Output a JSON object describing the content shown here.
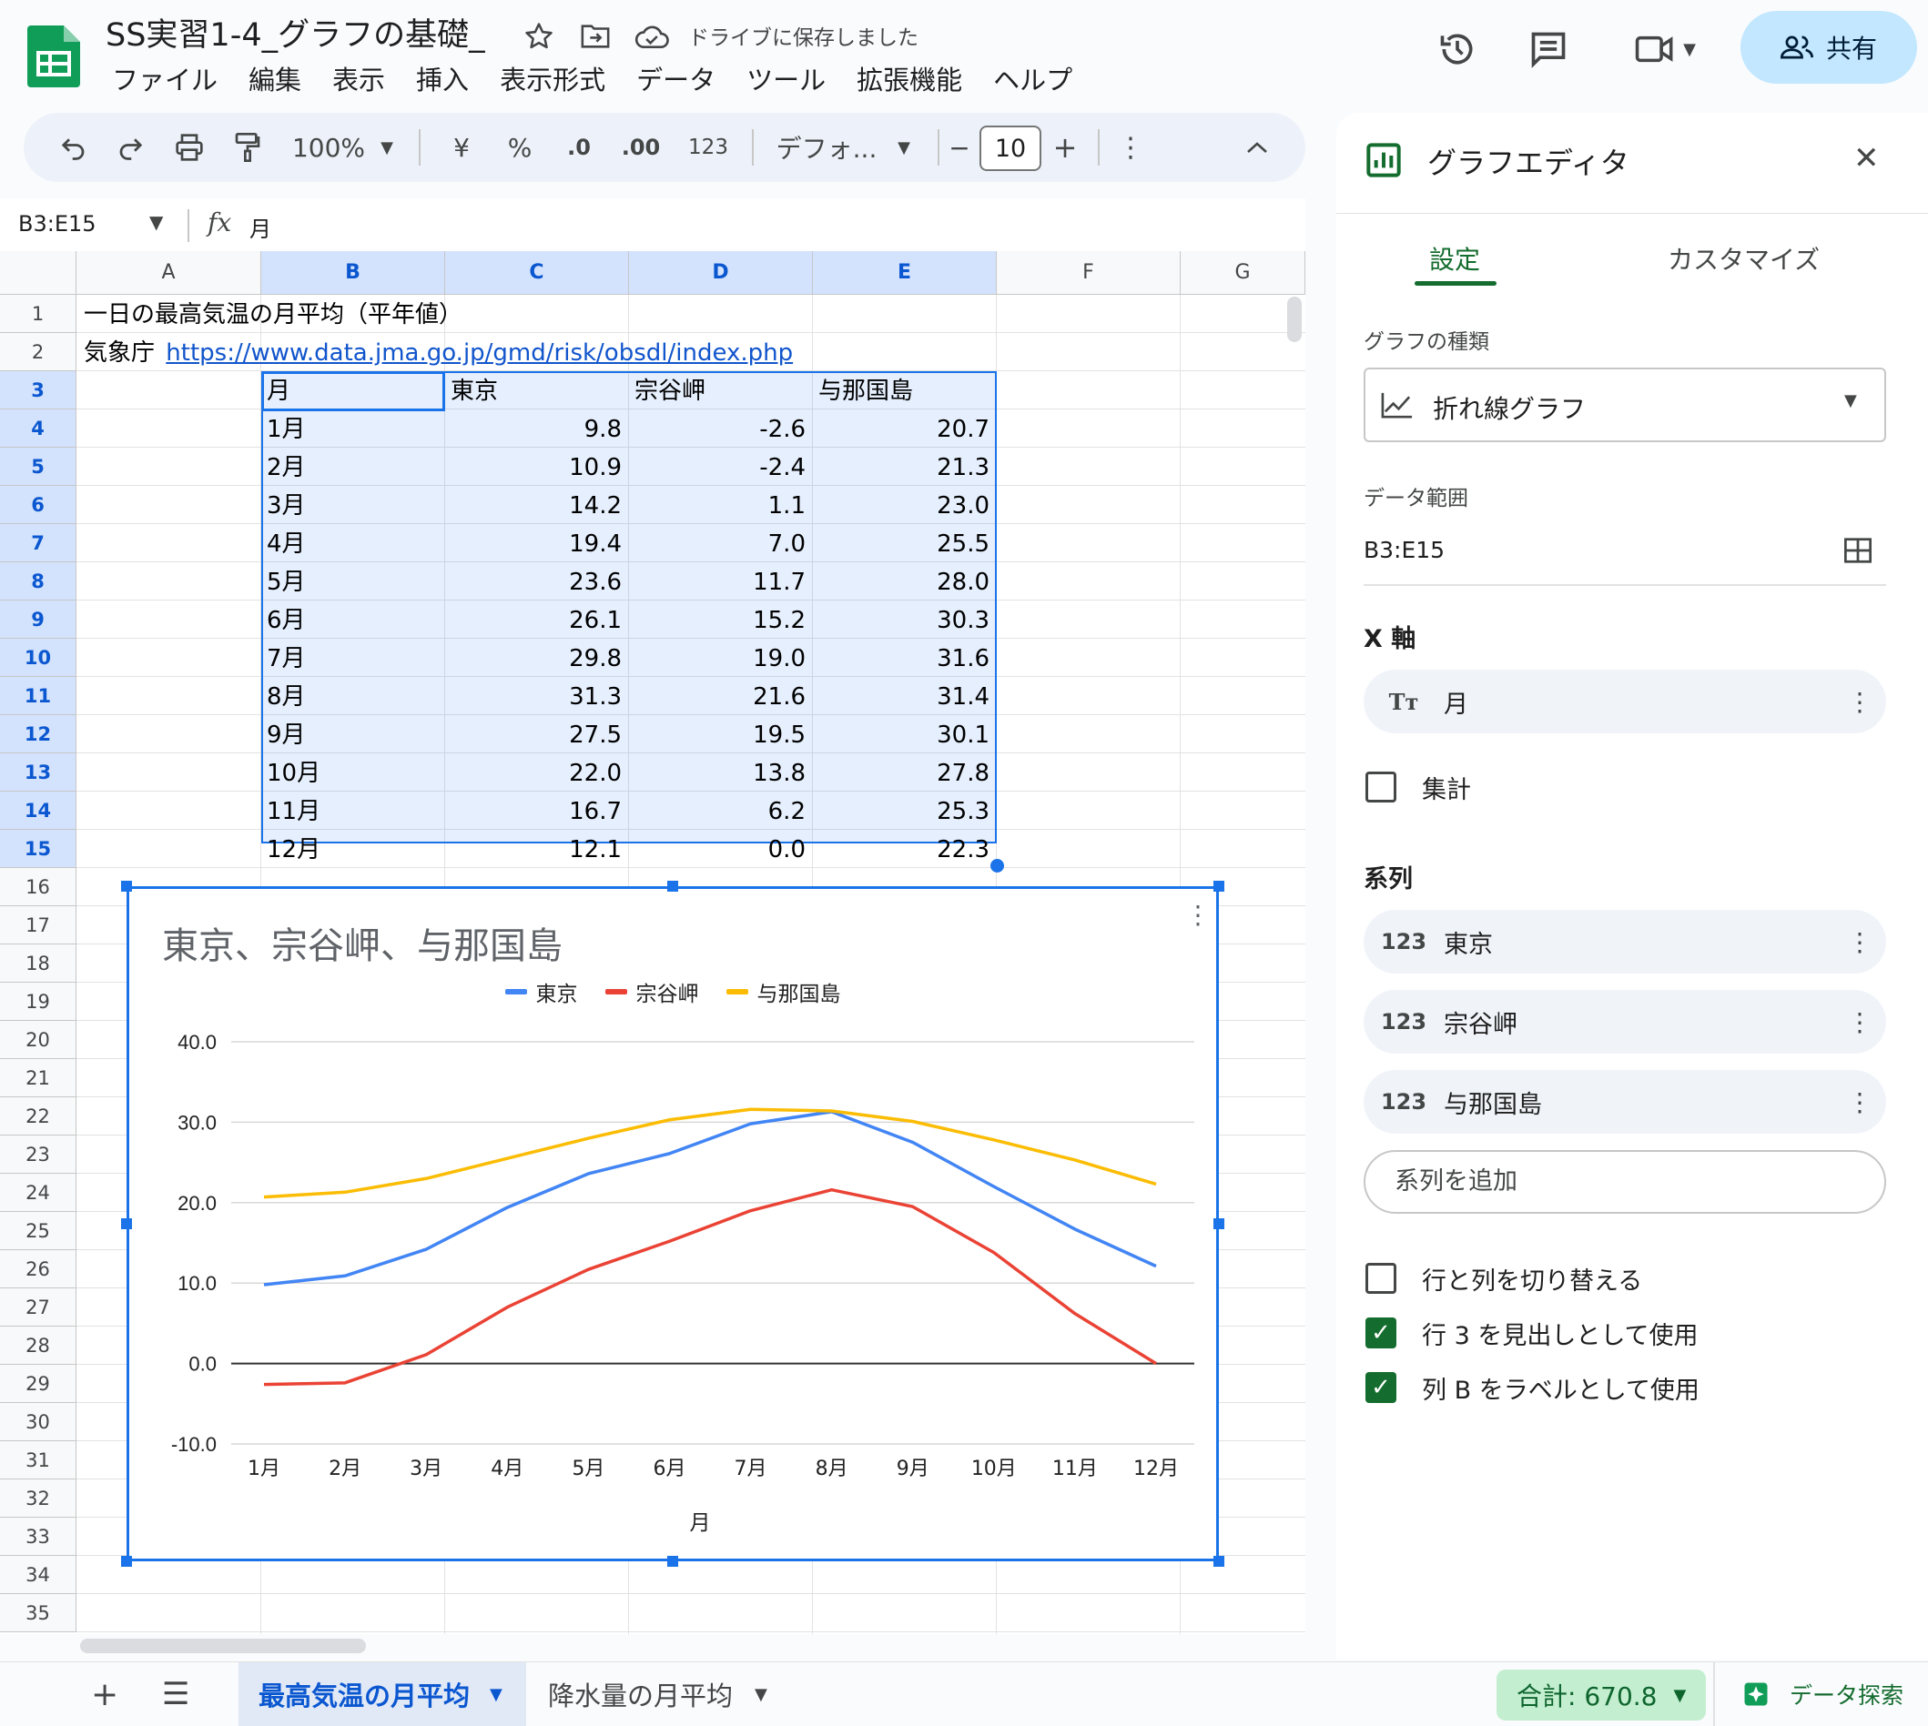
{
  "header": {
    "title": "SS実習1-4_グラフの基礎_",
    "save_status": "ドライブに保存しました",
    "share_label": "共有",
    "menu": [
      "ファイル",
      "編集",
      "表示",
      "挿入",
      "表示形式",
      "データ",
      "ツール",
      "拡張機能",
      "ヘルプ"
    ]
  },
  "toolbar": {
    "zoom": "100%",
    "currency": "¥",
    "percent": "%",
    "dec_decrease": ".0",
    "dec_increase": ".00",
    "number_format": "123",
    "font": "デフォ...",
    "font_size": "10"
  },
  "formula_bar": {
    "name_box": "B3:E15",
    "content": "月"
  },
  "grid": {
    "columns": [
      "A",
      "B",
      "C",
      "D",
      "E",
      "F",
      "G"
    ],
    "rows": [
      "1",
      "2",
      "3",
      "4",
      "5",
      "6",
      "7",
      "8",
      "9",
      "10",
      "11",
      "12",
      "13",
      "14",
      "15",
      "16",
      "17",
      "18",
      "19",
      "20",
      "21",
      "22",
      "23",
      "24",
      "25",
      "26",
      "27",
      "28",
      "29",
      "30",
      "31",
      "32",
      "33",
      "34",
      "35"
    ],
    "a1": "一日の最高気温の月平均（平年値）",
    "a2_prefix": "気象庁",
    "a2_link": "https://www.data.jma.go.jp/gmd/risk/obsdl/index.php",
    "table_header": [
      "月",
      "東京",
      "宗谷岬",
      "与那国島"
    ],
    "table_rows": [
      [
        "1月",
        "9.8",
        "-2.6",
        "20.7"
      ],
      [
        "2月",
        "10.9",
        "-2.4",
        "21.3"
      ],
      [
        "3月",
        "14.2",
        "1.1",
        "23.0"
      ],
      [
        "4月",
        "19.4",
        "7.0",
        "25.5"
      ],
      [
        "5月",
        "23.6",
        "11.7",
        "28.0"
      ],
      [
        "6月",
        "26.1",
        "15.2",
        "30.3"
      ],
      [
        "7月",
        "29.8",
        "19.0",
        "31.6"
      ],
      [
        "8月",
        "31.3",
        "21.6",
        "31.4"
      ],
      [
        "9月",
        "27.5",
        "19.5",
        "30.1"
      ],
      [
        "10月",
        "22.0",
        "13.8",
        "27.8"
      ],
      [
        "11月",
        "16.7",
        "6.2",
        "25.3"
      ],
      [
        "12月",
        "12.1",
        "0.0",
        "22.3"
      ]
    ]
  },
  "chart_data": {
    "type": "line",
    "title": "東京、宗谷岬、与那国島",
    "xlabel": "月",
    "ylabel": "",
    "categories": [
      "1月",
      "2月",
      "3月",
      "4月",
      "5月",
      "6月",
      "7月",
      "8月",
      "9月",
      "10月",
      "11月",
      "12月"
    ],
    "series": [
      {
        "name": "東京",
        "color": "#4285f4",
        "values": [
          9.8,
          10.9,
          14.2,
          19.4,
          23.6,
          26.1,
          29.8,
          31.3,
          27.5,
          22.0,
          16.7,
          12.1
        ]
      },
      {
        "name": "宗谷岬",
        "color": "#ea4335",
        "values": [
          -2.6,
          -2.4,
          1.1,
          7.0,
          11.7,
          15.2,
          19.0,
          21.6,
          19.5,
          13.8,
          6.2,
          0.0
        ]
      },
      {
        "name": "与那国島",
        "color": "#fbbc04",
        "values": [
          20.7,
          21.3,
          23.0,
          25.5,
          28.0,
          30.3,
          31.6,
          31.4,
          30.1,
          27.8,
          25.3,
          22.3
        ]
      }
    ],
    "ylim": [
      -10,
      40
    ],
    "yticks": [
      "40.0",
      "30.0",
      "20.0",
      "10.0",
      "0.0",
      "-10.0"
    ],
    "ytick_values": [
      40,
      30,
      20,
      10,
      0,
      -10
    ],
    "grid": true,
    "legend": "top"
  },
  "panel": {
    "title": "グラフエディタ",
    "tabs": [
      "設定",
      "カスタマイズ"
    ],
    "chart_type_label": "グラフの種類",
    "chart_type": "折れ線グラフ",
    "data_range_label": "データ範囲",
    "data_range": "B3:E15",
    "x_axis_label": "X 軸",
    "x_axis_item": "月",
    "aggregate_label": "集計",
    "series_label": "系列",
    "series_items": [
      "東京",
      "宗谷岬",
      "与那国島"
    ],
    "series_icon_text": "123",
    "add_series": "系列を追加",
    "switch_rows_cols": "行と列を切り替える",
    "use_row_header": "行 3 を見出しとして使用",
    "use_col_labels": "列 B をラベルとして使用"
  },
  "bottombar": {
    "sheets": [
      "最高気温の月平均",
      "降水量の月平均"
    ],
    "sum": "合計: 670.8",
    "explore": "データ探索"
  }
}
